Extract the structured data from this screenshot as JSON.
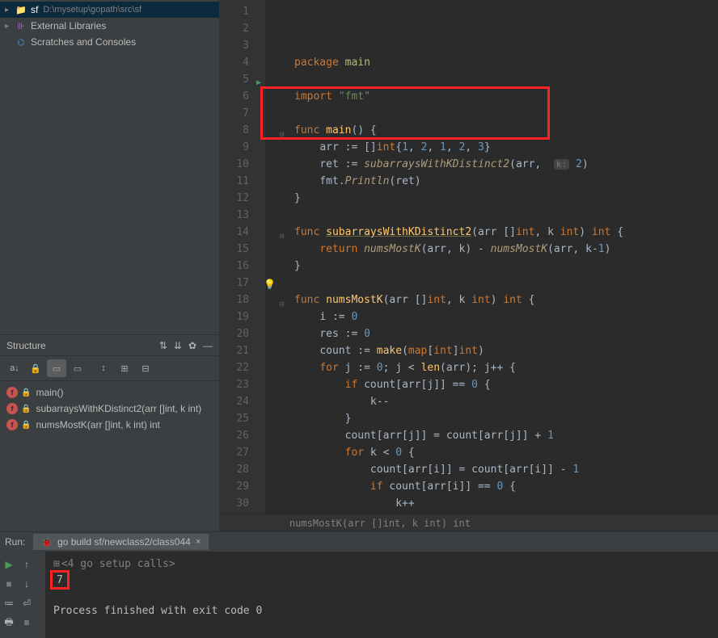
{
  "project": {
    "root_name": "sf",
    "root_path": "D:\\mysetup\\gopath\\src\\sf",
    "ext_libs": "External Libraries",
    "scratches": "Scratches and Consoles"
  },
  "structure": {
    "title": "Structure",
    "items": [
      {
        "label": "main()"
      },
      {
        "label": "subarraysWithKDistinct2(arr []int, k int)"
      },
      {
        "label": "numsMostK(arr []int, k int) int"
      }
    ]
  },
  "code": {
    "lines": [
      {
        "n": 1,
        "html": "<span class='kw'>package</span> <span class='pkg'>main</span>"
      },
      {
        "n": 2,
        "html": ""
      },
      {
        "n": 3,
        "html": "<span class='kw'>import</span> <span class='str'>\"fmt\"</span>"
      },
      {
        "n": 4,
        "html": ""
      },
      {
        "n": 5,
        "html": "<span class='kw'>func</span> <span class='fnd'>main</span>() {",
        "fold": true,
        "run": true
      },
      {
        "n": 6,
        "html": "    <span class='ident'>arr</span> := []<span class='typ'>int</span>{<span class='num'>1</span>, <span class='num'>2</span>, <span class='num'>1</span>, <span class='num'>2</span>, <span class='num'>3</span>}"
      },
      {
        "n": 7,
        "html": "    <span class='ident'>ret</span> := <span class='call'>subarraysWithKDistinct2</span>(arr,  <span class='param-hint'>k:</span> <span class='num'>2</span>)"
      },
      {
        "n": 8,
        "html": "    fmt.<span class='call'>Println</span>(ret)"
      },
      {
        "n": 9,
        "html": "}"
      },
      {
        "n": 10,
        "html": ""
      },
      {
        "n": 11,
        "html": "<span class='kw'>func</span> <span class='fnd underline'>subarraysWithKDistinct2</span>(arr []<span class='typ'>int</span>, k <span class='typ'>int</span>) <span class='typ'>int</span> {",
        "fold": true
      },
      {
        "n": 12,
        "html": "    <span class='kw'>return</span> <span class='call'>numsMostK</span>(arr, k) - <span class='call'>numsMostK</span>(arr, k-<span class='num'>1</span>)"
      },
      {
        "n": 13,
        "html": "}"
      },
      {
        "n": 14,
        "html": ""
      },
      {
        "n": 15,
        "html": "<span class='kw'>func</span> <span class='fnd'>numsMostK</span>(arr []<span class='typ'>int</span>, k <span class='typ'>int</span>) <span class='typ'>int</span> {",
        "fold": true
      },
      {
        "n": 16,
        "html": "    <span class='ident'>i</span> := <span class='num'>0</span>"
      },
      {
        "n": 17,
        "html": "    <span class='ident'>res</span> := <span class='num'>0</span>",
        "bulb": true
      },
      {
        "n": 18,
        "html": "    <span class='ident'>count</span> := <span class='fn'>make</span>(<span class='kw'>map</span>[<span class='typ'>int</span>]<span class='typ'>int</span>)"
      },
      {
        "n": 19,
        "html": "    <span class='kw'>for</span> <span class='ident'>j</span> := <span class='num'>0</span>; j &lt; <span class='fn'>len</span>(arr); j++ {"
      },
      {
        "n": 20,
        "html": "        <span class='kw'>if</span> count[arr[j]] == <span class='num'>0</span> {"
      },
      {
        "n": 21,
        "html": "            k--"
      },
      {
        "n": 22,
        "html": "        }"
      },
      {
        "n": 23,
        "html": "        count[arr[j]] = count[arr[j]] + <span class='num'>1</span>"
      },
      {
        "n": 24,
        "html": "        <span class='kw'>for</span> k &lt; <span class='num'>0</span> {"
      },
      {
        "n": 25,
        "html": "            count[arr[i]] = count[arr[i]] - <span class='num'>1</span>"
      },
      {
        "n": 26,
        "html": "            <span class='kw'>if</span> count[arr[i]] == <span class='num'>0</span> {"
      },
      {
        "n": 27,
        "html": "                k++"
      },
      {
        "n": 28,
        "html": "            }"
      },
      {
        "n": 29,
        "html": "            i++"
      },
      {
        "n": 30,
        "html": "        }"
      }
    ]
  },
  "breadcrumb": "numsMostK(arr []int, k int) int",
  "run": {
    "label": "Run:",
    "config": "go build sf/newclass2/class044",
    "setup": "<4 go setup calls>",
    "output": "7",
    "exit": "Process finished with exit code 0"
  }
}
